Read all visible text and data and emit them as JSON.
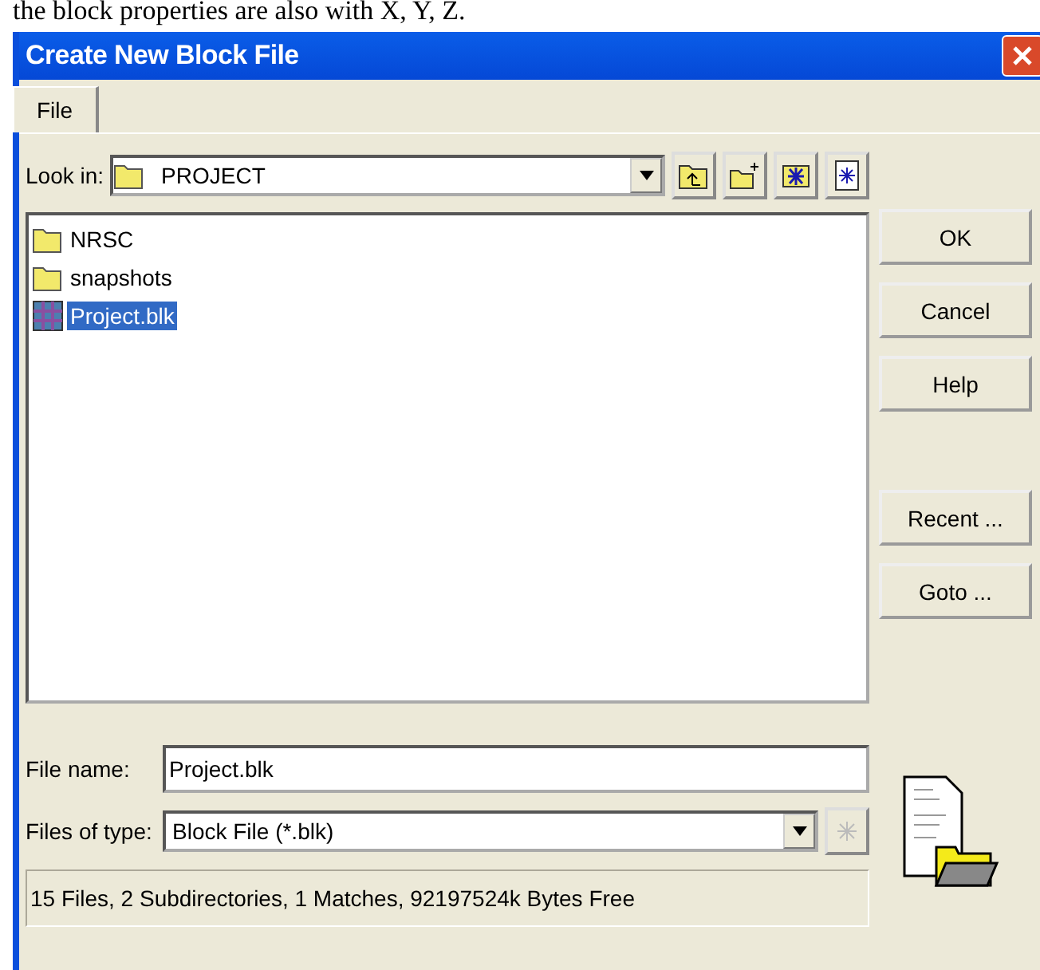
{
  "caption": "the block properties are also with X, Y, Z.",
  "window": {
    "title": "Create New Block File"
  },
  "tabs": [
    {
      "label": "File",
      "selected": true
    }
  ],
  "look_in": {
    "label": "Look in:",
    "value": "PROJECT"
  },
  "files": [
    {
      "name": "NRSC",
      "kind": "folder",
      "selected": false
    },
    {
      "name": "snapshots",
      "kind": "folder",
      "selected": false
    },
    {
      "name": "Project.blk",
      "kind": "block",
      "selected": true
    }
  ],
  "buttons": [
    "OK",
    "Cancel",
    "Help"
  ],
  "extra_buttons": [
    "Recent ...",
    "Goto ..."
  ],
  "file_name": {
    "label": "File name:",
    "value": "Project.blk"
  },
  "file_type": {
    "label": "Files of type:",
    "value": "Block File (*.blk)"
  },
  "status": "15 Files, 2 Subdirectories, 1 Matches, 92197524k Bytes Free"
}
